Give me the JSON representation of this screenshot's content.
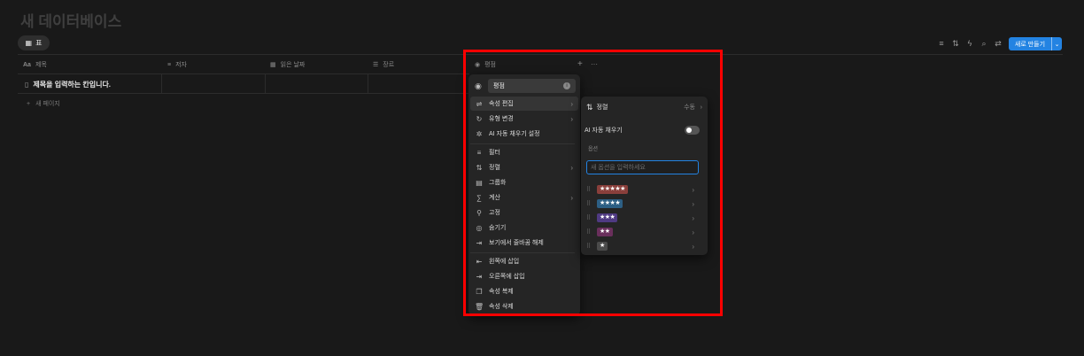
{
  "page_title": "새 데이터베이스",
  "view_tab": {
    "icon": "table-icon",
    "label": "표"
  },
  "toolbar": {
    "icons": [
      "filter-icon",
      "sort-icon",
      "lightning-icon",
      "search-icon",
      "settings-icon"
    ],
    "new_button_label": "새로 만들기"
  },
  "columns": [
    {
      "icon": "Aa",
      "label": "제목"
    },
    {
      "icon": "≡",
      "label": "저자"
    },
    {
      "icon": "▦",
      "label": "읽은 날짜"
    },
    {
      "icon": "☰",
      "label": "장르"
    },
    {
      "icon": "◉",
      "label": "평점"
    }
  ],
  "header_actions": {
    "add": "+",
    "more": "···"
  },
  "rows": [
    {
      "title": "제목을 입력하는 칸입니다."
    }
  ],
  "new_page_label": "새 페이지",
  "property_menu": {
    "name_value": "평점",
    "info_glyph": "i",
    "items": [
      {
        "icon": "⇌",
        "label": "속성 편집",
        "chevron": true
      },
      {
        "icon": "↻",
        "label": "유형 변경",
        "chevron": true
      },
      {
        "icon": "✲",
        "label": "AI 자동 채우기 설정",
        "chevron": false
      },
      {
        "icon": "≡",
        "label": "필터",
        "chevron": false
      },
      {
        "icon": "⇅",
        "label": "정렬",
        "chevron": true
      },
      {
        "icon": "▤",
        "label": "그룹화",
        "chevron": false
      },
      {
        "icon": "∑",
        "label": "계산",
        "chevron": true
      },
      {
        "icon": "⚲",
        "label": "고정",
        "chevron": false
      },
      {
        "icon": "◎",
        "label": "숨기기",
        "chevron": false
      },
      {
        "icon": "⇥",
        "label": "보기에서 줄바꿈 해제",
        "chevron": false
      },
      {
        "icon": "⇤",
        "label": "왼쪽에 삽입",
        "chevron": false
      },
      {
        "icon": "⇥",
        "label": "오른쪽에 삽입",
        "chevron": false
      },
      {
        "icon": "❐",
        "label": "속성 복제",
        "chevron": false
      },
      {
        "icon": "🗑",
        "label": "속성 삭제",
        "chevron": false
      }
    ]
  },
  "edit_panel": {
    "sort_icon": "⇅",
    "sort_label": "정렬",
    "sort_value": "수동",
    "ai_label": "AI 자동 채우기",
    "ai_enabled": false,
    "options_heading": "옵션",
    "option_placeholder": "새 옵션을 입력하세요",
    "options": [
      {
        "label": "★★★★★",
        "color": "#8a3f3b"
      },
      {
        "label": "★★★★",
        "color": "#2d5f84"
      },
      {
        "label": "★★★",
        "color": "#4f3a82"
      },
      {
        "label": "★★",
        "color": "#6a2f5c"
      },
      {
        "label": "★",
        "color": "#4a4a4a"
      }
    ]
  }
}
